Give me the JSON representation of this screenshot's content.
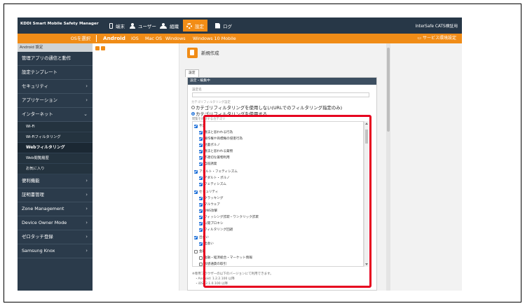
{
  "app": {
    "brand": "KDDI Smart Mobile Safety Manager",
    "org": "InterSafe CATS検証用"
  },
  "topnav": [
    {
      "label": "端末",
      "icon": "phone-icon"
    },
    {
      "label": "ユーザー",
      "icon": "user-icon"
    },
    {
      "label": "組織",
      "icon": "organization-icon"
    },
    {
      "label": "設定",
      "icon": "gear-icon"
    },
    {
      "label": "ログ",
      "icon": "log-icon"
    }
  ],
  "osbar": {
    "select_label": "OSを選択",
    "tabs": [
      "Android",
      "iOS",
      "Mac OS",
      "Windows",
      "Windows 10 Mobile"
    ],
    "settings_label": "サービス環境設定",
    "settings_icon": "monitor-icon"
  },
  "sidebar": {
    "header": "Android 設定",
    "items": [
      {
        "label": "管理アプリの通信と動作",
        "chevron": ""
      },
      {
        "label": "設定テンプレート",
        "chevron": ""
      },
      {
        "label": "セキュリティ",
        "chevron": "›"
      },
      {
        "label": "アプリケーション",
        "chevron": "›"
      },
      {
        "label": "インターネット",
        "chevron": "⌄"
      }
    ],
    "sub_items": [
      {
        "label": "Wi-Fi"
      },
      {
        "label": "Wi-Fiフィルタリング"
      },
      {
        "label": "Webフィルタリング"
      },
      {
        "label": "Web閲覧履歴"
      },
      {
        "label": "お気に入り"
      }
    ],
    "items2": [
      {
        "label": "便利機能",
        "chevron": "›"
      },
      {
        "label": "証明書管理",
        "chevron": "›"
      },
      {
        "label": "Zone Management",
        "chevron": "›"
      },
      {
        "label": "Device Owner Mode",
        "chevron": "›"
      },
      {
        "label": "ゼロタッチ登録",
        "chevron": "›"
      },
      {
        "label": "Samsung Knox",
        "chevron": "›"
      }
    ]
  },
  "content": {
    "title": "新規作成",
    "tab": "設定",
    "panel_header": "設定・編集中",
    "name_label": "設定名",
    "name_value": "",
    "category_filter_label": "カテゴリフィルタリング設定",
    "radio_options": [
      {
        "label": "カテゴリフィルタリングを使用しない(URLでのフィルタリング指定のみ)",
        "selected": false
      },
      {
        "label": "カテゴリフィルタリングを使用する",
        "selected": true
      }
    ],
    "block_label": "閲覧を規制するカテゴリ",
    "tree": [
      {
        "label": "不法",
        "checked": true
      },
      {
        "label": "違法と思われる行為",
        "checked": true
      },
      {
        "label": "著作権や商標権の侵害行為",
        "checked": true
      },
      {
        "label": "児童ポルノ",
        "checked": true
      },
      {
        "label": "違法と思われる薬物",
        "checked": true
      },
      {
        "label": "不適切な薬物利用",
        "checked": true
      },
      {
        "label": "自殺誘発",
        "checked": true
      },
      {
        "label": "アダルト・フェティシズム",
        "checked": true
      },
      {
        "label": "アダルト・ポルノ",
        "checked": true
      },
      {
        "label": "フェティシズム",
        "checked": true
      },
      {
        "label": "セキュリティ",
        "checked": true
      },
      {
        "label": "クラッキング",
        "checked": true
      },
      {
        "label": "マルウェア",
        "checked": true
      },
      {
        "label": "DNS攻撃",
        "checked": true
      },
      {
        "label": "フィッシング詐欺・ワンクリック詐欺",
        "checked": true
      },
      {
        "label": "公開プロキシ",
        "checked": true
      },
      {
        "label": "フィルタリング回避",
        "checked": true
      },
      {
        "label": "出会い",
        "checked": true
      },
      {
        "label": "出会い",
        "checked": true
      },
      {
        "label": "金融",
        "checked": false
      },
      {
        "label": "金融・経済総合・マーケット情報",
        "checked": false
      },
      {
        "label": "仮想通貨の取引",
        "checked": false
      }
    ],
    "notes": [
      "※専用ブラウザーの以下のバージョンにて利用できます。",
      "・Android: 1.2.2.100 以降",
      "・iOS: 2.1.0.100 以降"
    ]
  },
  "colors": {
    "accent": "#f08c17",
    "topbar": "#273747",
    "sidebar": "#2b3b4b",
    "highlight": "#e6001f",
    "check": "#1a6ed8"
  }
}
